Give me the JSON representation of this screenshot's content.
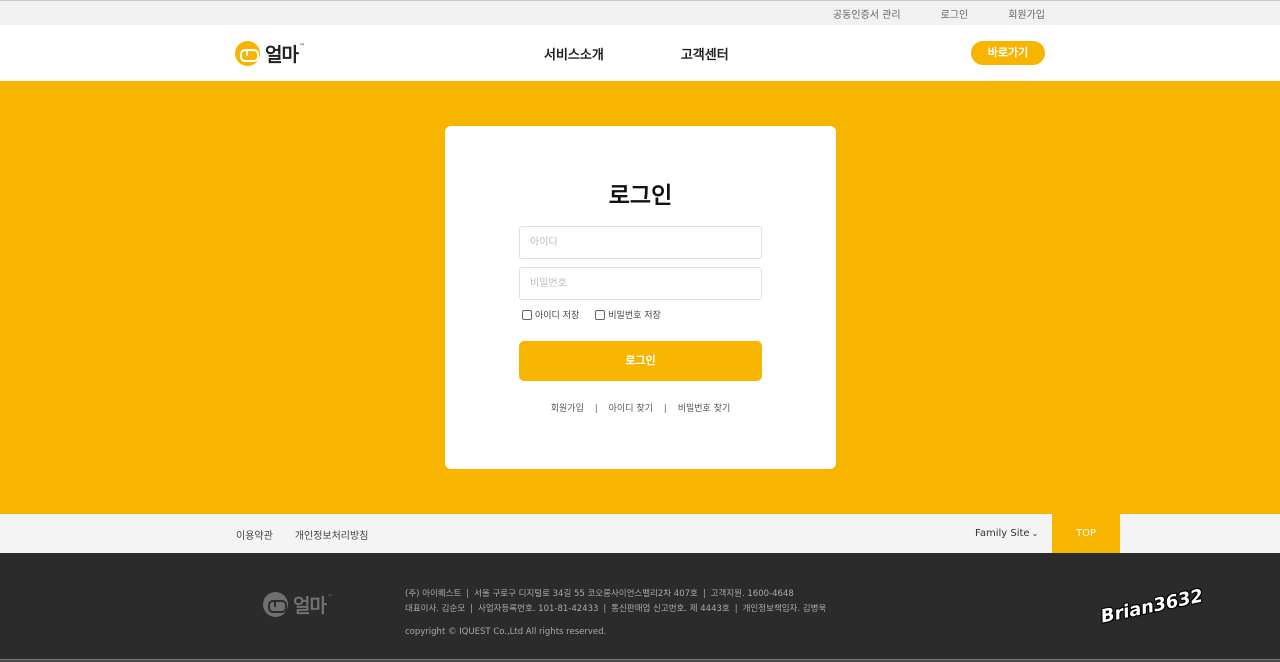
{
  "util_bar": {
    "links": [
      "공동인증서 관리",
      "로그인",
      "회원가입"
    ]
  },
  "header": {
    "logo_text": "얼마",
    "logo_tm": "™",
    "nav": [
      "서비스소개",
      "고객센터"
    ],
    "shortcut_button": "바로가기"
  },
  "login": {
    "title": "로그인",
    "id_placeholder": "아이디",
    "password_placeholder": "비밀번호",
    "save_id_label": "아이디 저장",
    "save_password_label": "비밀번호 저장",
    "submit_label": "로그인",
    "links": [
      "회원가입",
      "아이디 찾기",
      "비밀번호 찾기"
    ],
    "separator": "|"
  },
  "footer_nav": {
    "links": [
      "이용약관",
      "개인정보처리방침"
    ],
    "family_site": "Family Site",
    "top_button": "TOP"
  },
  "footer": {
    "logo_text": "얼마",
    "logo_tm": "™",
    "line1": [
      "(주) 아이퀘스트",
      "서울 구로구 디지털로 34길 55 코오롱사이언스밸리2차 407호",
      "고객지원. 1600-4648"
    ],
    "line2": [
      "대표이사. 김순모",
      "사업자등록번호. 101-81-42433",
      "통신판매업 신고번호. 제 4443호",
      "개인정보책임자. 김병욱"
    ],
    "copyright": "copyright © IQUEST Co.,Ltd All rights reserved.",
    "separator": "|"
  },
  "watermark": "Brian3632",
  "colors": {
    "accent": "#f7b500",
    "footer_bg": "#2b2b2b"
  }
}
